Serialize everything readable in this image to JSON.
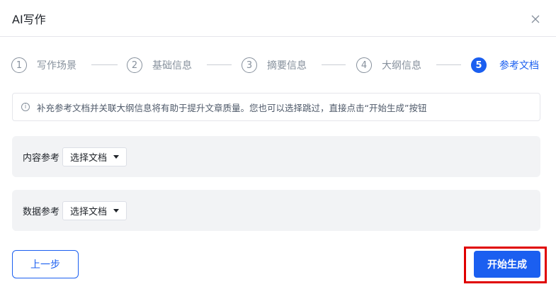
{
  "dialog": {
    "title": "AI写作",
    "close_icon": "close-icon"
  },
  "steps": [
    {
      "number": "1",
      "label": "写作场景",
      "state": "inactive"
    },
    {
      "number": "2",
      "label": "基础信息",
      "state": "inactive"
    },
    {
      "number": "3",
      "label": "摘要信息",
      "state": "inactive"
    },
    {
      "number": "4",
      "label": "大纲信息",
      "state": "inactive"
    },
    {
      "number": "5",
      "label": "参考文档",
      "state": "active"
    }
  ],
  "tip": {
    "icon": "info-icon",
    "text": "补充参考文档并关联大纲信息将有助于提升文章质量。您也可以选择跳过，直接点击“开始生成”按钮"
  },
  "content_ref": {
    "label": "内容参考",
    "select_label": "选择文档"
  },
  "data_ref": {
    "label": "数据参考",
    "select_label": "选择文档"
  },
  "footer": {
    "prev_label": "上一步",
    "start_label": "开始生成"
  },
  "colors": {
    "accent": "#1b5ff0",
    "highlight": "#e00000"
  }
}
